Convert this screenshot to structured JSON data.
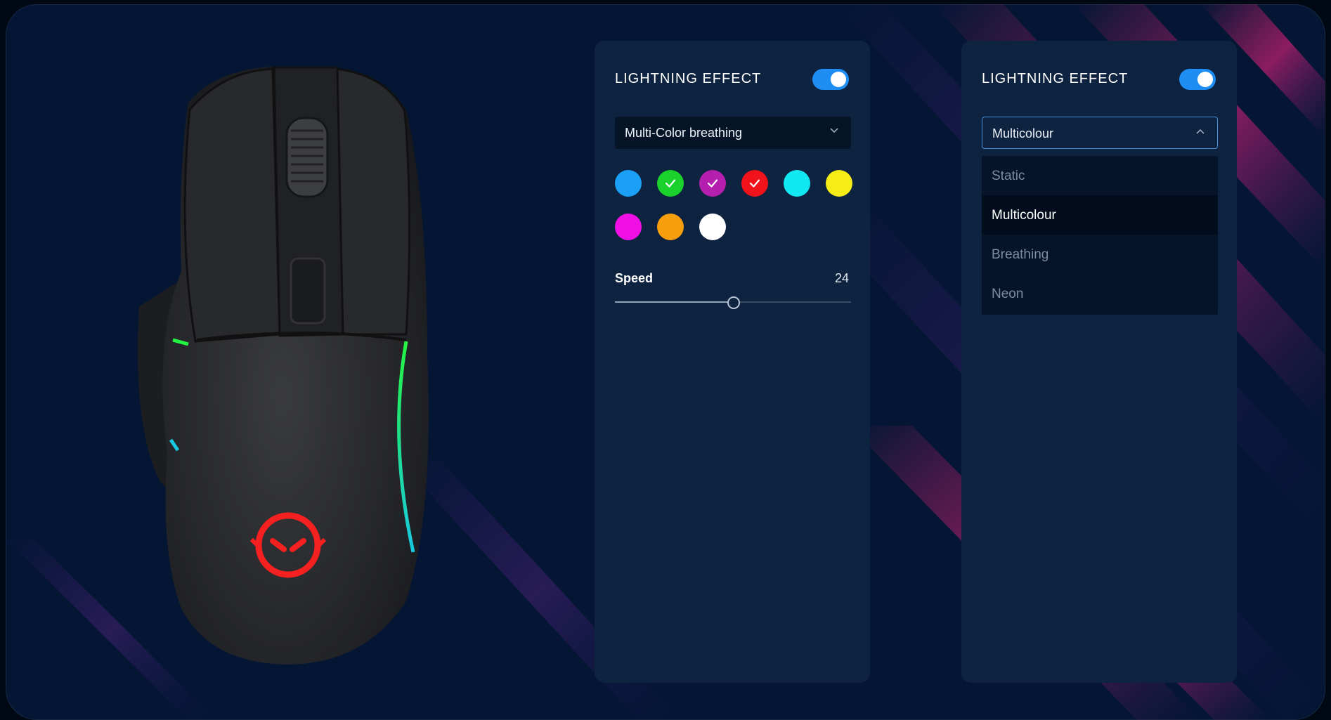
{
  "panels": [
    {
      "title": "LIGHTNING EFFECT",
      "toggle_on": true,
      "mode_value": "Multi-Color breathing",
      "colors": [
        {
          "name": "blue",
          "hex": "#1aa0f5",
          "checked": false
        },
        {
          "name": "green",
          "hex": "#1bd12b",
          "checked": true
        },
        {
          "name": "purple",
          "hex": "#b51fae",
          "checked": true
        },
        {
          "name": "red",
          "hex": "#f0131b",
          "checked": true
        },
        {
          "name": "cyan",
          "hex": "#12e8f2",
          "checked": false
        },
        {
          "name": "yellow",
          "hex": "#f6ec16",
          "checked": false
        },
        {
          "name": "magenta",
          "hex": "#f010e6",
          "checked": false
        },
        {
          "name": "orange",
          "hex": "#f79e0c",
          "checked": false
        },
        {
          "name": "white",
          "hex": "#ffffff",
          "checked": false
        }
      ],
      "speed_label": "Speed",
      "speed_value": "24",
      "speed_fraction": 0.5
    },
    {
      "title": "LIGHTNING EFFECT",
      "toggle_on": true,
      "mode_value": "Multicolour",
      "options": [
        "Static",
        "Multicolour",
        "Breathing",
        "Neon"
      ],
      "selected_option": "Multicolour"
    }
  ],
  "colors": {
    "background": "#041634",
    "panel": "#0e2340",
    "accent": "#1e8ef5",
    "stripe": "#c0206a"
  },
  "icons": {
    "toggle": "toggle-switch",
    "chevron_closed": "chevron-down-icon",
    "chevron_open": "chevron-up-icon",
    "check": "check-icon"
  }
}
